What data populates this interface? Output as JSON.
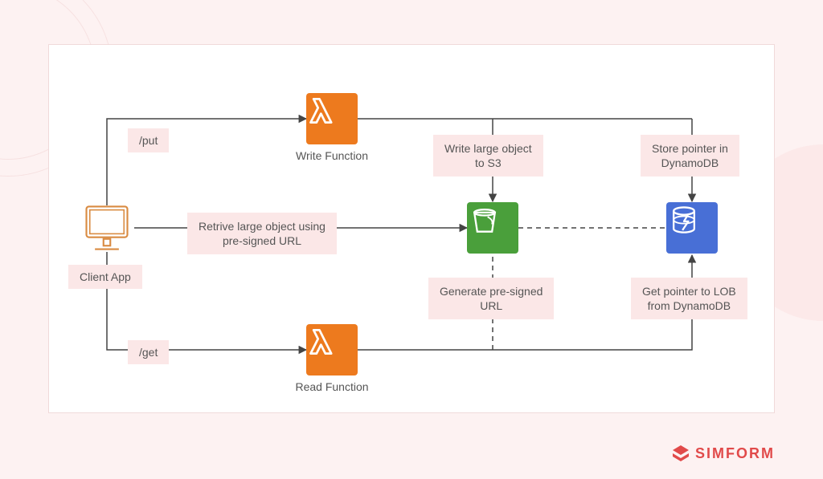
{
  "labels": {
    "client_app": "Client App",
    "put": "/put",
    "get": "/get",
    "retrieve": "Retrive large object using\npre-signed URL",
    "write_fn": "Write Function",
    "read_fn": "Read Function",
    "write_s3": "Write large object\nto S3",
    "store_ptr": "Store pointer in\nDynamoDB",
    "gen_presigned": "Generate pre-signed\nURL",
    "get_ptr": "Get pointer to LOB\nfrom DynamoDB"
  },
  "brand": "SIMFORM",
  "colors": {
    "lambda": "#ed7a1e",
    "s3": "#4a9f3b",
    "dynamodb": "#486fd6",
    "label_bg": "#fbe7e7",
    "accent": "#e14a4a"
  }
}
